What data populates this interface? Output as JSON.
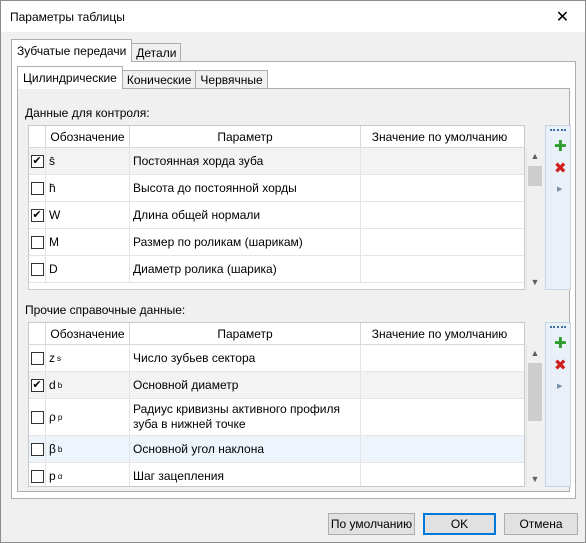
{
  "window": {
    "title": "Параметры таблицы",
    "close_icon": "close-icon"
  },
  "outer_tabs": [
    {
      "label": "Зубчатые передачи",
      "active": true
    },
    {
      "label": "Детали",
      "active": false
    }
  ],
  "inner_tabs": [
    {
      "label": "Цилиндрические",
      "active": true
    },
    {
      "label": "Конические",
      "active": false
    },
    {
      "label": "Червячные",
      "active": false
    }
  ],
  "control_section": {
    "label": "Данные для контроля:",
    "columns": [
      "Обозначение",
      "Параметр",
      "Значение по умолчанию"
    ],
    "rows": [
      {
        "checked": true,
        "symbol": "s̄",
        "sub": "",
        "param": "Постоянная хорда зуба",
        "value": ""
      },
      {
        "checked": false,
        "symbol": "h̄",
        "sub": "",
        "param": "Высота до постоянной хорды",
        "value": ""
      },
      {
        "checked": true,
        "symbol": "W",
        "sub": "",
        "param": "Длина общей нормали",
        "value": ""
      },
      {
        "checked": false,
        "symbol": "M",
        "sub": "",
        "param": "Размер по роликам (шарикам)",
        "value": ""
      },
      {
        "checked": false,
        "symbol": "D",
        "sub": "",
        "param": "Диаметр ролика (шарика)",
        "value": ""
      }
    ]
  },
  "reference_section": {
    "label": "Прочие справочные данные:",
    "columns": [
      "Обозначение",
      "Параметр",
      "Значение по умолчанию"
    ],
    "rows": [
      {
        "checked": false,
        "symbol": "z",
        "sub": "s",
        "param": "Число зубьев сектора",
        "value": ""
      },
      {
        "checked": true,
        "symbol": "d",
        "sub": "b",
        "param": "Основной диаметр",
        "value": ""
      },
      {
        "checked": false,
        "symbol": "ρ",
        "sub": "p",
        "param": "Радиус кривизны активного профиля зуба в нижней точке",
        "value": ""
      },
      {
        "checked": false,
        "symbol": "β",
        "sub": "b",
        "param": "Основной угол наклона",
        "value": ""
      },
      {
        "checked": false,
        "symbol": "p",
        "sub": "α",
        "param": "Шаг зацепления",
        "value": ""
      }
    ]
  },
  "side_tools": {
    "add_icon": "add-icon",
    "delete_icon": "delete-icon",
    "expand_icon": "expand-icon"
  },
  "buttons": {
    "defaults": "По умолчанию",
    "ok": "OK",
    "cancel": "Отмена"
  },
  "colors": {
    "add": "#2e9d2e",
    "delete": "#d22020",
    "selection": "#edf4fc",
    "accent": "#0078d7"
  }
}
